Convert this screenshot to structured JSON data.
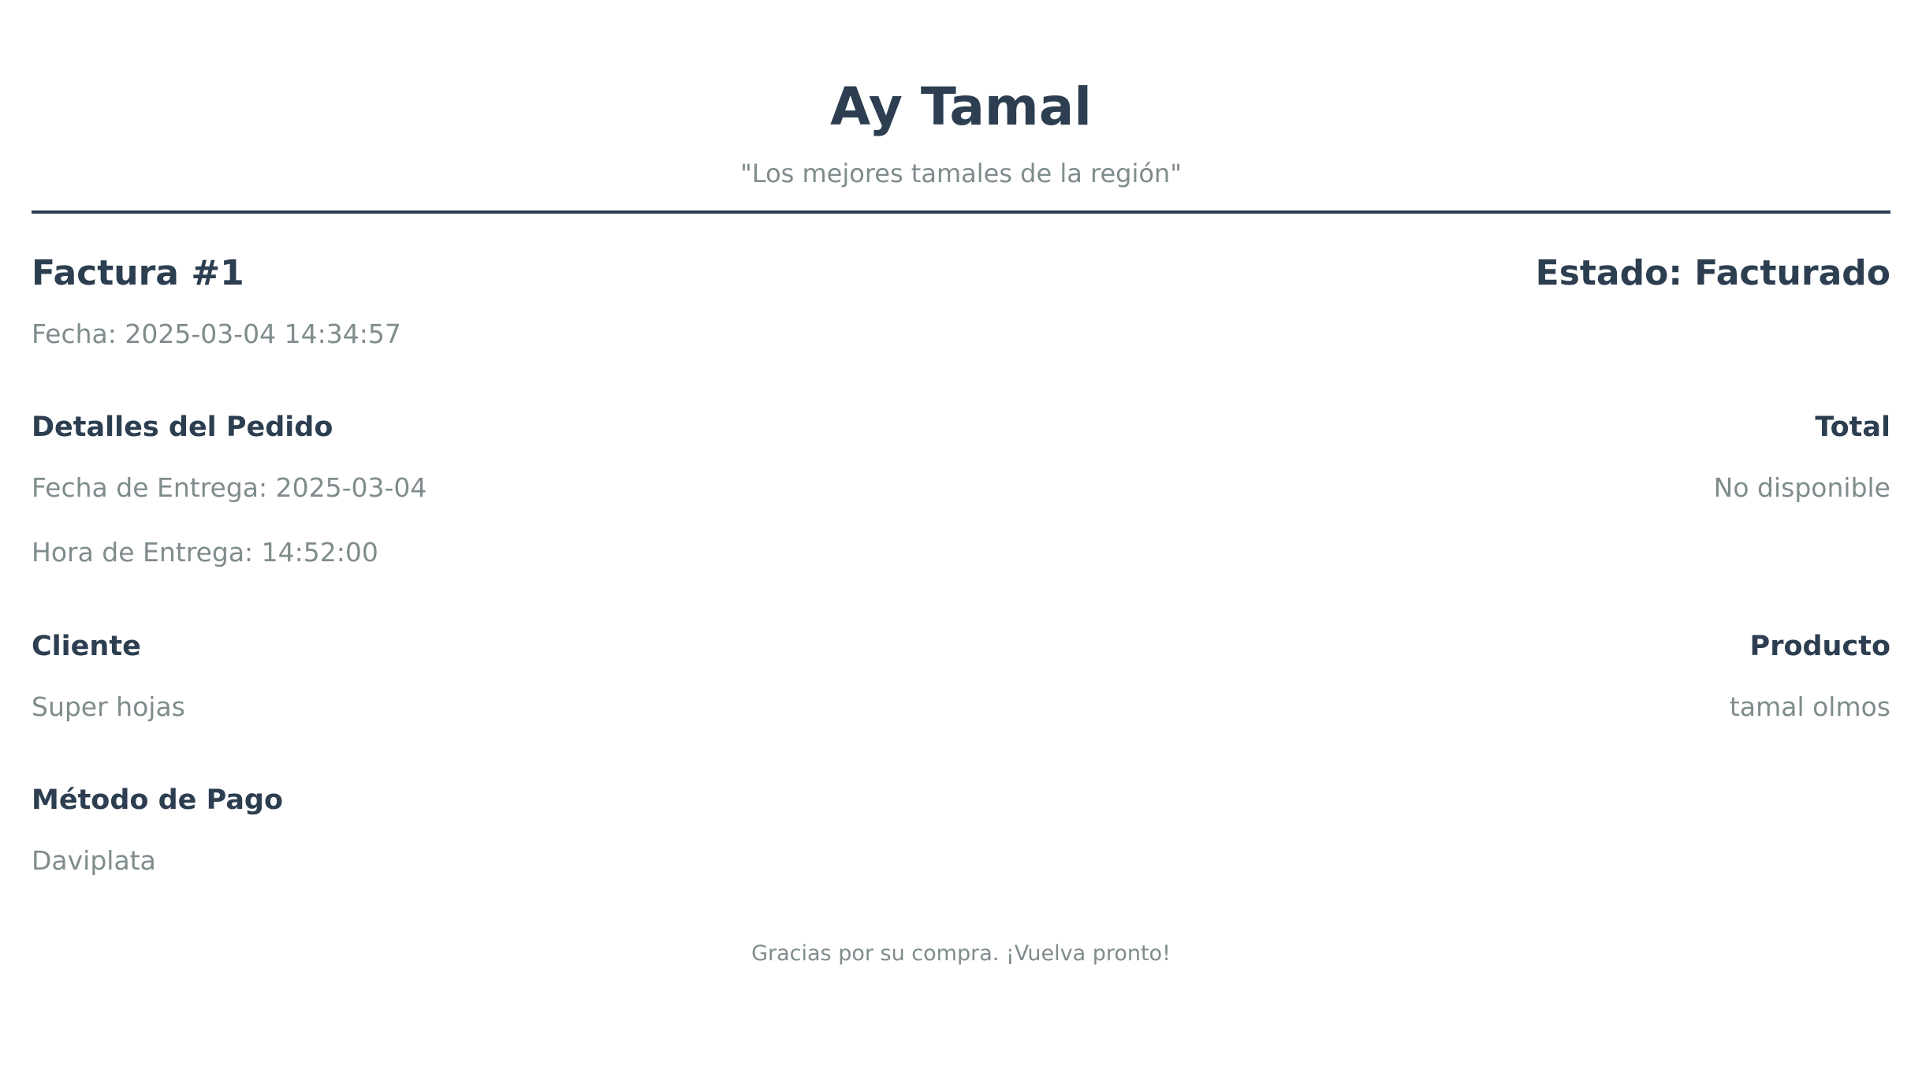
{
  "brand": {
    "title": "Ay Tamal",
    "slogan": "\"Los mejores tamales de la región\""
  },
  "invoice": {
    "title": "Factura #1",
    "status": "Estado: Facturado",
    "date": "Fecha: 2025-03-04 14:34:57"
  },
  "order": {
    "heading": "Detalles del Pedido",
    "delivery_date": "Fecha de Entrega: 2025-03-04",
    "delivery_time": "Hora de Entrega: 14:52:00"
  },
  "total": {
    "heading": "Total",
    "value": "No disponible"
  },
  "client": {
    "heading": "Cliente",
    "value": "Super hojas"
  },
  "product": {
    "heading": "Producto",
    "value": "tamal olmos"
  },
  "payment": {
    "heading": "Método de Pago",
    "value": "Daviplata"
  },
  "footer": {
    "text": "Gracias por su compra. ¡Vuelva pronto!"
  },
  "colors": {
    "heading": "#2c3e50",
    "muted": "#7f8c8d",
    "divider": "#2c3e50"
  }
}
